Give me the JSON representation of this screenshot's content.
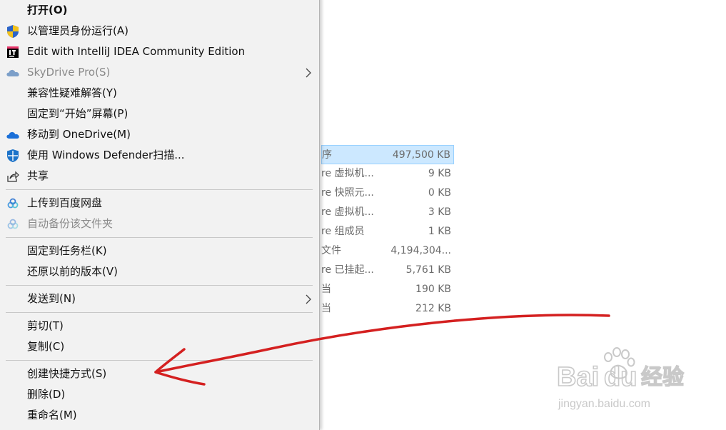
{
  "context_menu": {
    "items": [
      {
        "label": "打开(O)"
      },
      {
        "label": "以管理员身份运行(A)"
      },
      {
        "label": "Edit with IntelliJ IDEA Community Edition"
      },
      {
        "label": "SkyDrive Pro(S)"
      },
      {
        "label": "兼容性疑难解答(Y)"
      },
      {
        "label": "固定到“开始”屏幕(P)"
      },
      {
        "label": "移动到 OneDrive(M)"
      },
      {
        "label": "使用 Windows Defender扫描..."
      },
      {
        "label": "共享"
      },
      {
        "label": "上传到百度网盘"
      },
      {
        "label": "自动备份该文件夹"
      },
      {
        "label": "固定到任务栏(K)"
      },
      {
        "label": "还原以前的版本(V)"
      },
      {
        "label": "发送到(N)"
      },
      {
        "label": "剪切(T)"
      },
      {
        "label": "复制(C)"
      },
      {
        "label": "创建快捷方式(S)"
      },
      {
        "label": "删除(D)"
      },
      {
        "label": "重命名(M)"
      }
    ]
  },
  "file_list": {
    "rows": [
      {
        "name": "序",
        "size": "497,500 KB"
      },
      {
        "name": "re 虚拟机...",
        "size": "9 KB"
      },
      {
        "name": "re 快照元...",
        "size": "0 KB"
      },
      {
        "name": "re 虚拟机...",
        "size": "3 KB"
      },
      {
        "name": "re 组成员",
        "size": "1 KB"
      },
      {
        "name": "文件",
        "size": "4,194,304..."
      },
      {
        "name": "re 已挂起...",
        "size": "5,761 KB"
      },
      {
        "name": "当",
        "size": "190 KB"
      },
      {
        "name": "当",
        "size": "212 KB"
      }
    ]
  },
  "watermark": {
    "brand": "Baidu经验",
    "url": "jingyan.baidu.com"
  },
  "colors": {
    "menu_bg": "#f2f2f2",
    "selection_bg": "#cce8ff",
    "annotation_red": "#d42020",
    "onedrive_blue": "#1a6fd8"
  }
}
